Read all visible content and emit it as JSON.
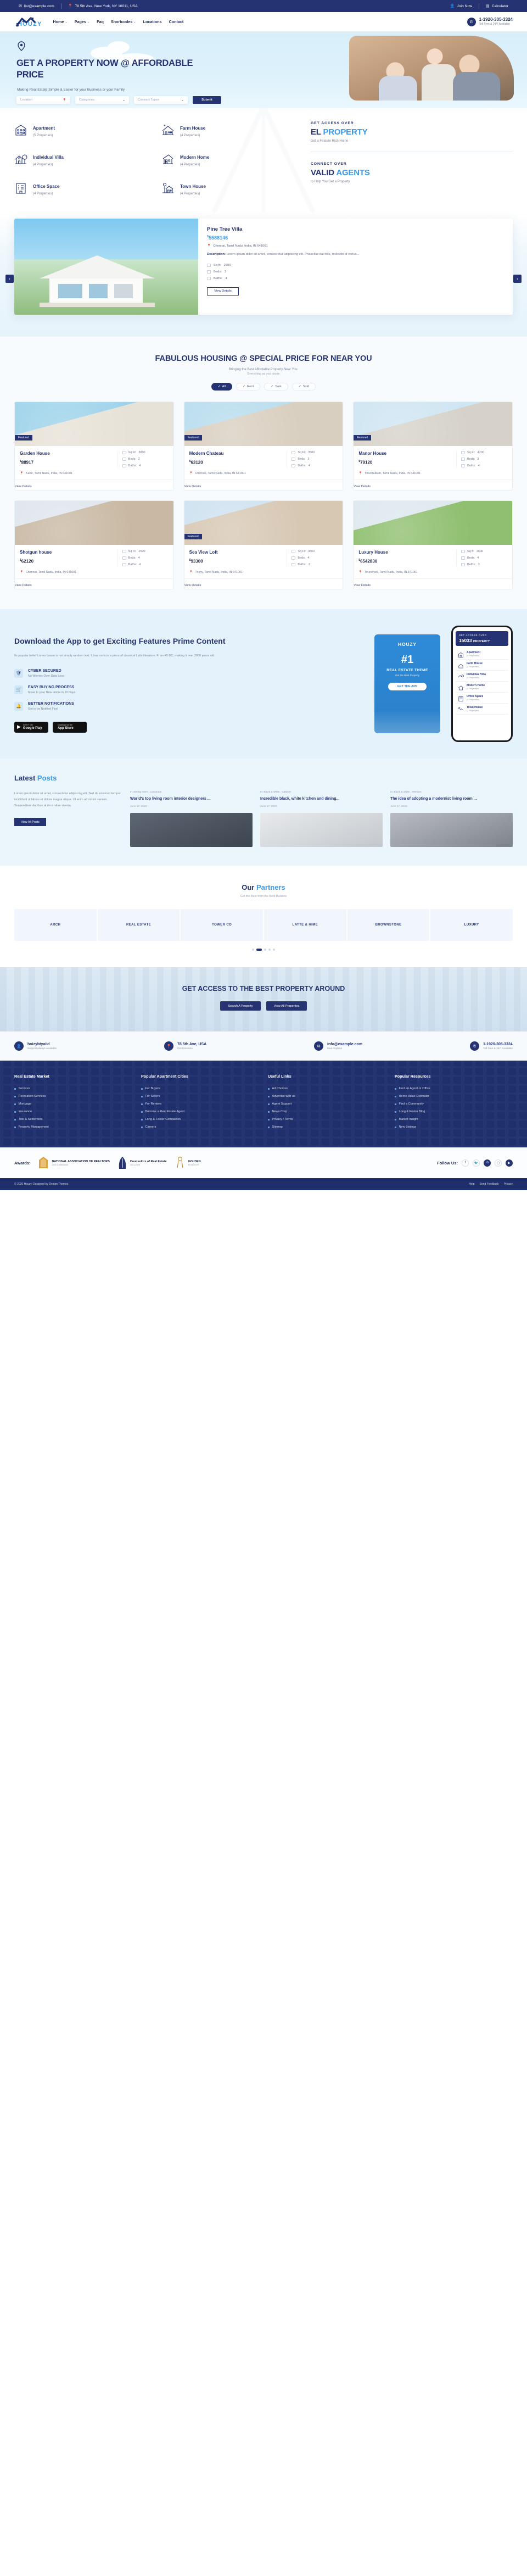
{
  "topbar": {
    "email": "list@example.com",
    "address": "78 5th Ave, New York, NY 10011, USA",
    "join": "Join Now",
    "calculator": "Calculator"
  },
  "header": {
    "logo": "HOUZY",
    "nav": [
      {
        "label": "Home",
        "caret": true
      },
      {
        "label": "Pages",
        "caret": true
      },
      {
        "label": "Faq",
        "caret": false
      },
      {
        "label": "Shortcodes",
        "caret": true
      },
      {
        "label": "Locations",
        "caret": false
      },
      {
        "label": "Contact",
        "caret": false
      }
    ],
    "phone": "1-1920-305-3324",
    "phone_sub": "Toll Free & 24/7 Available"
  },
  "hero": {
    "title": "GET A PROPERTY NOW @ AFFORDABLE PRICE",
    "subtitle": "Making Real Estate Simple & Easier for your Business or your Family",
    "search": {
      "location_placeholder": "Location",
      "categories_label": "Categories",
      "contract_label": "Contract Types",
      "submit": "Submit"
    }
  },
  "categories": [
    {
      "name": "Apartment",
      "count": "(5 Properties)",
      "icon": "apartment-icon"
    },
    {
      "name": "Farm House",
      "count": "(4 Properties)",
      "icon": "farmhouse-icon"
    },
    {
      "name": "Individual Villa",
      "count": "(4 Properties)",
      "icon": "villa-icon"
    },
    {
      "name": "Modern Home",
      "count": "(4 Properties)",
      "icon": "modern-home-icon"
    },
    {
      "name": "Office Space",
      "count": "(4 Properties)",
      "icon": "office-icon"
    },
    {
      "name": "Town House",
      "count": "(4 Properties)",
      "icon": "townhouse-icon"
    }
  ],
  "access": {
    "kicker1": "GET ACCESS OVER",
    "big1_dark": "EL",
    "big1_blue": "PROPERTY",
    "sub1": "Get a Feature Rich Home",
    "kicker2": "CONNECT OVER",
    "big2_dark": "VALID",
    "big2_blue": "AGENTS",
    "sub2": "to Help You Get a Property"
  },
  "featured": {
    "title": "Pine Tree Villa",
    "price": "5588146",
    "currency": "$",
    "location": "Chennai, Tamil Nadu, India, IN 641001",
    "desc_label": "Description:",
    "desc": "Lorem ipsum dolor sit amet, consectetur adipiscing elit. Phasellus dui felis, molestie id varius...",
    "specs": [
      {
        "label": "Sq ft:",
        "value": "2500"
      },
      {
        "label": "Beds:",
        "value": "3"
      },
      {
        "label": "Baths:",
        "value": "4"
      }
    ],
    "button": "View Details",
    "arrow_prev": "‹",
    "arrow_next": "›"
  },
  "fabulous": {
    "title": "FABULOUS HOUSING @ SPECIAL PRICE FOR NEAR YOU",
    "subtitle": "Bringing the Best Affordable Property Near You.",
    "subtitle2": "Everything as you desire",
    "tabs": [
      {
        "label": "All",
        "active": true
      },
      {
        "label": "Rent",
        "active": false
      },
      {
        "label": "Sale",
        "active": false
      },
      {
        "label": "Sold",
        "active": false
      }
    ],
    "properties": [
      {
        "name": "Garden House",
        "price": "88917",
        "currency": "$",
        "featured": "Featured",
        "sqft_label": "Sq Ft:",
        "sqft": "3800",
        "beds_label": "Beds:",
        "beds": "2",
        "baths_label": "Baths:",
        "baths": "4",
        "location": "Karur, Tamil Nadu, India, IN 641001",
        "cta": "View Details"
      },
      {
        "name": "Modern Chateau",
        "price": "63120",
        "currency": "$",
        "featured": "Featured",
        "sqft_label": "Sq Ft:",
        "sqft": "3500",
        "beds_label": "Beds:",
        "beds": "3",
        "baths_label": "Baths:",
        "baths": "4",
        "location": "Chennai, Tamil Nadu, India, IN 641001",
        "cta": "View Details"
      },
      {
        "name": "Manor House",
        "price": "79120",
        "currency": "$",
        "featured": "Featured",
        "sqft_label": "Sq Ft:",
        "sqft": "4200",
        "beds_label": "Beds:",
        "beds": "3",
        "baths_label": "Baths:",
        "baths": "4",
        "location": "Thoothukudi, Tamil Nadu, India, IN 641001",
        "cta": "View Details"
      },
      {
        "name": "Shotgun house",
        "price": "62120",
        "currency": "$",
        "featured": "",
        "sqft_label": "Sq Ft:",
        "sqft": "2500",
        "beds_label": "Beds:",
        "beds": "4",
        "baths_label": "Baths:",
        "baths": "4",
        "location": "Chennai, Tamil Nadu, India, IN 641001",
        "cta": "View Details"
      },
      {
        "name": "Sea View Loft",
        "price": "93300",
        "currency": "$",
        "featured": "Featured",
        "sqft_label": "Sq Ft:",
        "sqft": "3600",
        "beds_label": "Beds:",
        "beds": "4",
        "baths_label": "Baths:",
        "baths": "3",
        "location": "Trichy, Tamil Nadu, India, IN 641001",
        "cta": "View Details"
      },
      {
        "name": "Luxury House",
        "price": "6542830",
        "currency": "$",
        "featured": "",
        "sqft_label": "Sq ft:",
        "sqft": "3600",
        "beds_label": "Beds:",
        "beds": "4",
        "baths_label": "Baths:",
        "baths": "3",
        "location": "Tirunelveli, Tamil Nadu, India, IN 641001",
        "cta": "View Details"
      }
    ]
  },
  "app": {
    "title": "Download the App to get Exciting Features Prime Content",
    "intro": "Its popular belief Lorem Ipsum is not simply random text. It has roots in a piece of classical Latin literature. From 45 BC, making it over 2000 years old.",
    "features": [
      {
        "title": "CYBER SECURED",
        "desc": "No Worries Over Data Loss",
        "icon": "shield-icon"
      },
      {
        "title": "EASY BUYING PROCESS",
        "desc": "Move to your New Home in 10 Days",
        "icon": "cart-icon"
      },
      {
        "title": "BETTER NOTIFICATIONS",
        "desc": "Get to be Notified First",
        "icon": "bell-icon"
      }
    ],
    "stores": [
      {
        "small": "GET IT ON",
        "big": "Google Play",
        "icon": "play-store-icon"
      },
      {
        "small": "Download on the",
        "big": "App Store",
        "icon": "apple-icon"
      }
    ],
    "card": {
      "logo": "HOUZY",
      "hash": "#1",
      "title": "REAL ESTATE THEME",
      "sub": "Get the Best Property",
      "button": "GET THE APP"
    },
    "phone": {
      "kicker": "GET ACCESS OVER",
      "count": "15033",
      "word": "PROPERTY",
      "list": [
        {
          "name": "Apartment",
          "count": "(5 Properties)"
        },
        {
          "name": "Farm House",
          "count": "(4 Properties)"
        },
        {
          "name": "Individual Villa",
          "count": "(4 Properties)"
        },
        {
          "name": "Modern Home",
          "count": "(4 Properties)"
        },
        {
          "name": "Office Space",
          "count": "(4 Properties)"
        },
        {
          "name": "Town House",
          "count": "(4 Properties)"
        }
      ]
    }
  },
  "blog": {
    "head_a": "Latest ",
    "head_b": "Posts",
    "text": "Lorem ipsum dolor sit amet, consectetur adipiscing elit. Sed do eiusmod tempor incididunt ut labore et dolore magna aliqua. Ut enim ad minim veniam. Suspendisse dapibus at risus vitae viverra.",
    "button": "View All Posts",
    "posts": [
      {
        "meta": "in: Dining room , Luxurious",
        "title": "World's top living room interior designers ...",
        "date": "June 17, 2020"
      },
      {
        "meta": "in: Black & white , Cabinet",
        "title": "Incredible black, white kitchen and dining...",
        "date": "June 17, 2020"
      },
      {
        "meta": "in: Black & white , Interiors",
        "title": "The idea of adopting a modernist living room ...",
        "date": "June 17, 2020"
      }
    ]
  },
  "partners": {
    "head_a": "Our ",
    "head_b": "Partners",
    "sub": "Get the Best from the Best Builders",
    "logos": [
      "ARCH",
      "REAL ESTATE",
      "TOWER CO",
      "LATTE & HIME",
      "BROWNSTONE",
      "LUXURY"
    ],
    "dots": [
      false,
      true,
      false,
      false,
      false
    ]
  },
  "cta": {
    "title": "GET ACCESS TO THE BEST PROPERTY AROUND",
    "btn1": "Search A Property",
    "btn2": "View All Properties"
  },
  "contact_bar": [
    {
      "title": "hoizybtyaiid",
      "sub": "Support always available",
      "icon": "user-icon"
    },
    {
      "title": "78 5th Ave, USA",
      "sub": "Get Direction",
      "icon": "pin-icon"
    },
    {
      "title": "info@example.com",
      "sub": "Mail Anytime",
      "icon": "mail-icon"
    },
    {
      "title": "1-1920-305-3324",
      "sub": "Toll Free & 24/7 Available",
      "icon": "phone-icon"
    }
  ],
  "footer": {
    "columns": [
      {
        "head": "Real Estate Market",
        "links": [
          "Services",
          "Recreation Services",
          "Mortgage",
          "Insurance",
          "Title & Settlement",
          "Property Management"
        ]
      },
      {
        "head": "Popular Apartment Cities",
        "links": [
          "For Buyers",
          "For Sellers",
          "For Renters",
          "Become a Real Estate Agent",
          "Long & Foster Companies",
          "Careers"
        ]
      },
      {
        "head": "Useful Links",
        "links": [
          "Ad Choices",
          "Advertise with us",
          "Agent Support",
          "News Corp",
          "Privacy / Terms",
          "Sitemap"
        ]
      },
      {
        "head": "Popular Resources",
        "links": [
          "Find an Agent or Office",
          "Home Value Estimator",
          "Find a Community",
          "Long & Foster Blog",
          "Market Insight",
          "New Listings"
        ]
      }
    ]
  },
  "awards": {
    "label": "Awards:",
    "badges": [
      {
        "title": "NATIONAL ASSOCIATION OF REALTORS",
        "sub": "2020 Certification"
      },
      {
        "title": "Counselors of Real Estate",
        "sub": "2001-2020"
      },
      {
        "title": "GOLDEN",
        "sub": "ESTD 1975"
      }
    ],
    "follow_label": "Follow Us:",
    "socials": [
      "facebook-icon",
      "twitter-icon",
      "linkedin-icon",
      "instagram-icon",
      "youtube-icon"
    ]
  },
  "copyright": {
    "text": "© 2020 Houzy. Designed by Design Themes.",
    "links": [
      "Help",
      "Send Feedback",
      "Privacy"
    ]
  }
}
